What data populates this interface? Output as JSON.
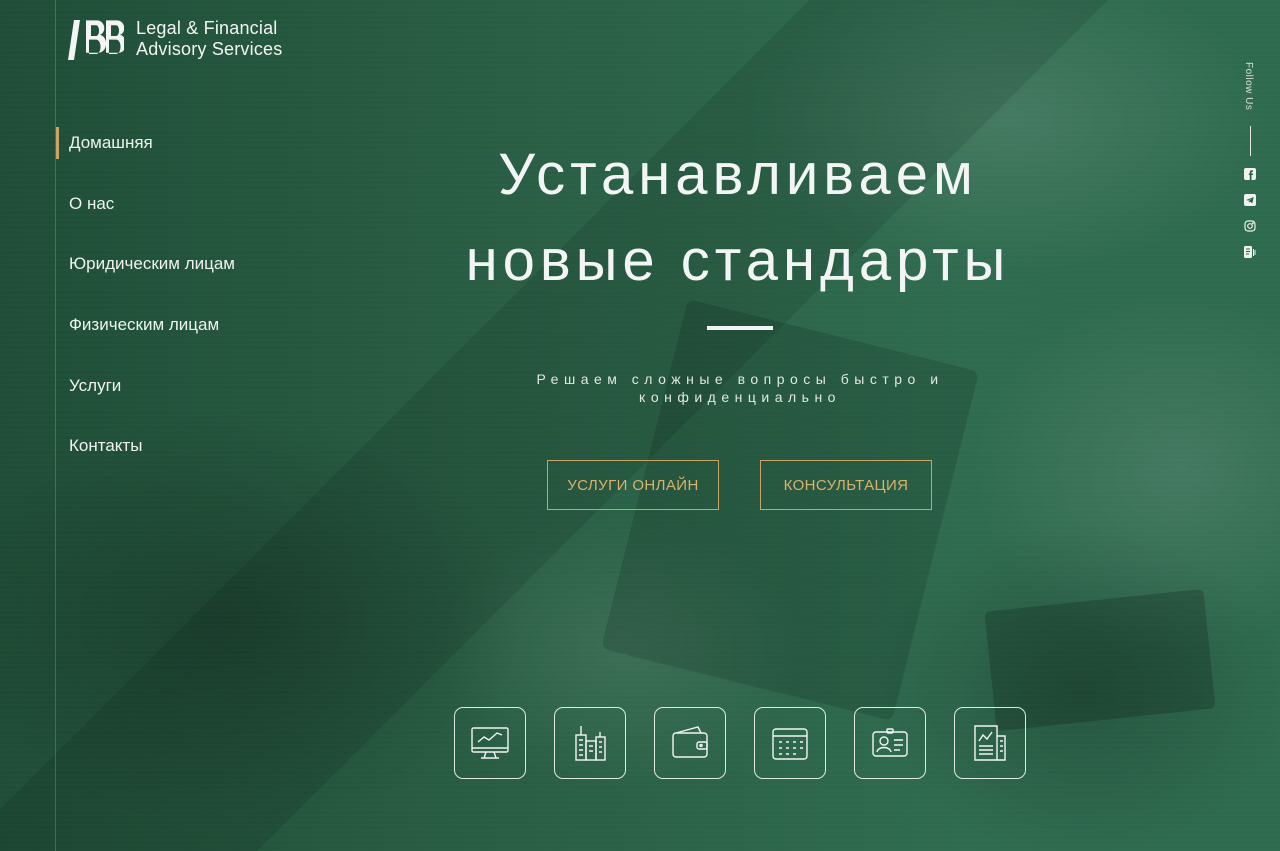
{
  "brand": {
    "line1": "Legal & Financial",
    "line2": "Advisory Services",
    "logo_icon": "ibb-logo"
  },
  "nav": {
    "items": [
      {
        "label": "Домашняя",
        "active": true
      },
      {
        "label": "О нас"
      },
      {
        "label": "Юридическим лицам"
      },
      {
        "label": "Физическим лицам"
      },
      {
        "label": "Услуги"
      },
      {
        "label": "Контакты"
      }
    ]
  },
  "hero": {
    "title_line1": "Устанавливаем",
    "title_line2": "новые стандарты",
    "subtitle": "Решаем сложные вопросы быстро и конфиденциально",
    "buttons": {
      "online": "УСЛУГИ ОНЛАЙН",
      "consult": "КОНСУЛЬТАЦИЯ"
    }
  },
  "features": [
    {
      "icon": "monitor-chart-icon"
    },
    {
      "icon": "buildings-icon"
    },
    {
      "icon": "wallet-icon"
    },
    {
      "icon": "calendar-icon"
    },
    {
      "icon": "id-card-icon"
    },
    {
      "icon": "newspaper-icon"
    }
  ],
  "social": {
    "follow_label": "Follow Us",
    "icons": [
      "facebook-icon",
      "telegram-icon",
      "instagram-icon",
      "rss-icon"
    ]
  },
  "colors": {
    "accent": "#c9a464",
    "background": "#2a5f45",
    "text": "#f3f5f4"
  }
}
